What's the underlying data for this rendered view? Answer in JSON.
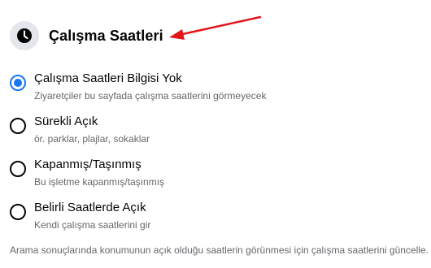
{
  "section": {
    "title": "Çalışma Saatleri",
    "icon": "clock-icon"
  },
  "colors": {
    "accent": "#1877f2",
    "arrow": "#e4161b",
    "secondary_text": "#65676b"
  },
  "options": [
    {
      "label": "Çalışma Saatleri Bilgisi Yok",
      "description": "Ziyaretçiler bu sayfada çalışma saatlerini görmeyecek",
      "selected": true
    },
    {
      "label": "Sürekli Açık",
      "description": "ör. parklar, plajlar, sokaklar",
      "selected": false
    },
    {
      "label": "Kapanmış/Taşınmış",
      "description": "Bu işletme kapanmış/taşınmış",
      "selected": false
    },
    {
      "label": "Belirli Saatlerde Açık",
      "description": "Kendi çalışma saatlerini gir",
      "selected": false
    }
  ],
  "footer_note": "Arama sonuçlarında konumunun açık olduğu saatlerin görünmesi için çalışma saatlerini güncelle."
}
